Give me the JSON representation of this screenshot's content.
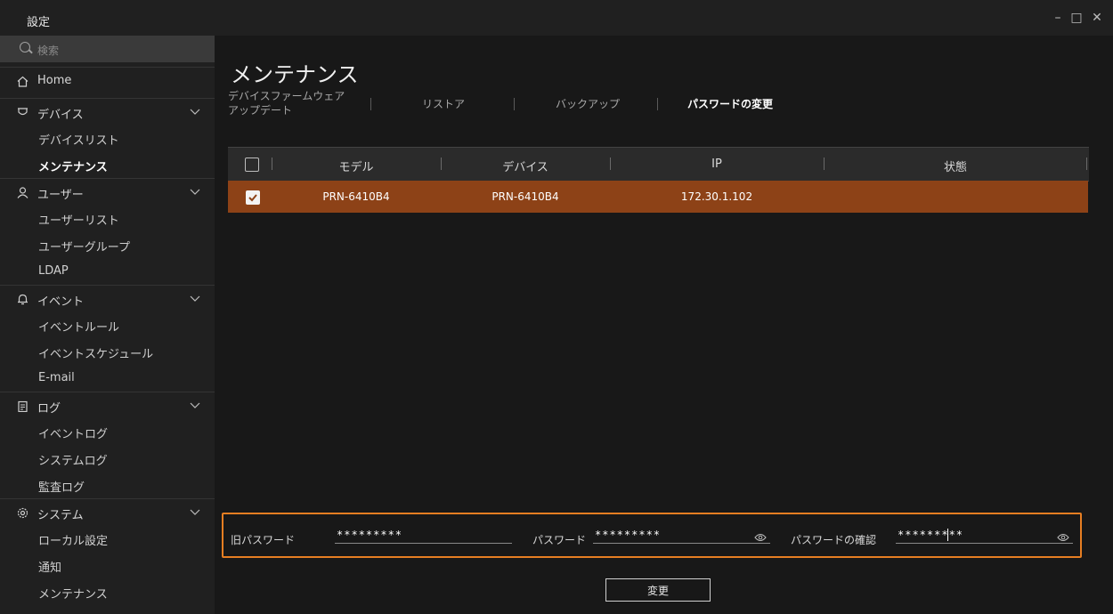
{
  "app": {
    "title": "設定"
  },
  "sidebar": {
    "search_placeholder": "検索",
    "items": [
      {
        "label": "Home",
        "icon": "home-icon"
      },
      {
        "label": "デバイス",
        "icon": "device-icon"
      },
      {
        "label": "デバイスリスト"
      },
      {
        "label": "メンテナンス",
        "active": true
      },
      {
        "label": "ユーザー",
        "icon": "user-icon"
      },
      {
        "label": "ユーザーリスト"
      },
      {
        "label": "ユーザーグループ"
      },
      {
        "label": "LDAP"
      },
      {
        "label": "イベント",
        "icon": "bell-icon"
      },
      {
        "label": "イベントルール"
      },
      {
        "label": "イベントスケジュール"
      },
      {
        "label": "E-mail"
      },
      {
        "label": "ログ",
        "icon": "log-icon"
      },
      {
        "label": "イベントログ"
      },
      {
        "label": "システムログ"
      },
      {
        "label": "監査ログ"
      },
      {
        "label": "システム",
        "icon": "gear-icon"
      },
      {
        "label": "ローカル設定"
      },
      {
        "label": "通知"
      },
      {
        "label": "メンテナンス"
      }
    ]
  },
  "main": {
    "title": "メンテナンス",
    "tabs": [
      {
        "label_line1": "デバイスファームウェア",
        "label_line2": "アップデート"
      },
      {
        "label": "リストア"
      },
      {
        "label": "バックアップ"
      },
      {
        "label": "パスワードの変更",
        "active": true
      }
    ]
  },
  "table": {
    "columns": [
      "モデル",
      "デバイス",
      "IP",
      "状態"
    ],
    "rows": [
      {
        "checked": true,
        "model": "PRN-6410B4",
        "device": "PRN-6410B4",
        "ip": "172.30.1.102",
        "status": ""
      }
    ]
  },
  "password_form": {
    "old_label": "旧パスワード",
    "old_value": "*********",
    "new_label": "パスワード",
    "new_value": "*********",
    "confirm_label": "パスワードの確認",
    "confirm_value": "*********"
  },
  "change_button": "変更",
  "colors": {
    "accent_orange": "#e67e22",
    "selected_row": "#8d4217"
  }
}
